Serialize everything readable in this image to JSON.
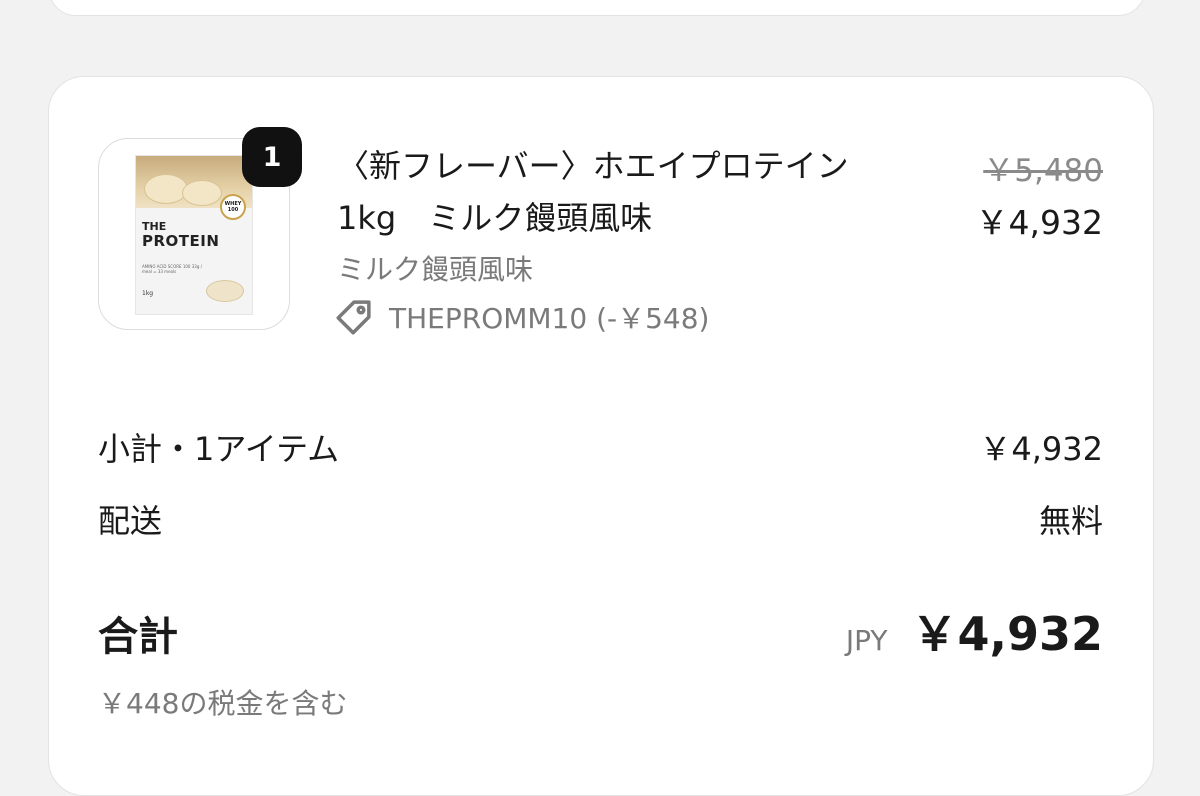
{
  "product": {
    "quantity_badge": "1",
    "title": "〈新フレーバー〉ホエイプロテイン1kg　ミルク饅頭風味",
    "variant": "ミルク饅頭風味",
    "discount_code": "THEPROMM10 (-￥548)",
    "price_original": "￥5,480",
    "price_current": "￥4,932",
    "image": {
      "brand_line1": "THE",
      "brand_line2": "PROTEIN",
      "badge": "WHEY 100",
      "small_text": "AMINO ACID SCORE 100 33g / meal = 33 meals",
      "weight": "1kg"
    }
  },
  "summary": {
    "subtotal_label": "小計・1アイテム",
    "subtotal_value": "￥4,932",
    "shipping_label": "配送",
    "shipping_value": "無料",
    "total_label": "合計",
    "total_currency": "JPY",
    "total_value": "￥4,932",
    "tax_note": "￥448の税金を含む"
  },
  "colors": {
    "page_background": "#f2f2f2",
    "card_background": "#ffffff",
    "badge_background": "#111111",
    "muted_text": "#7a7a7a"
  },
  "icons": {
    "discount": "tag-icon"
  }
}
